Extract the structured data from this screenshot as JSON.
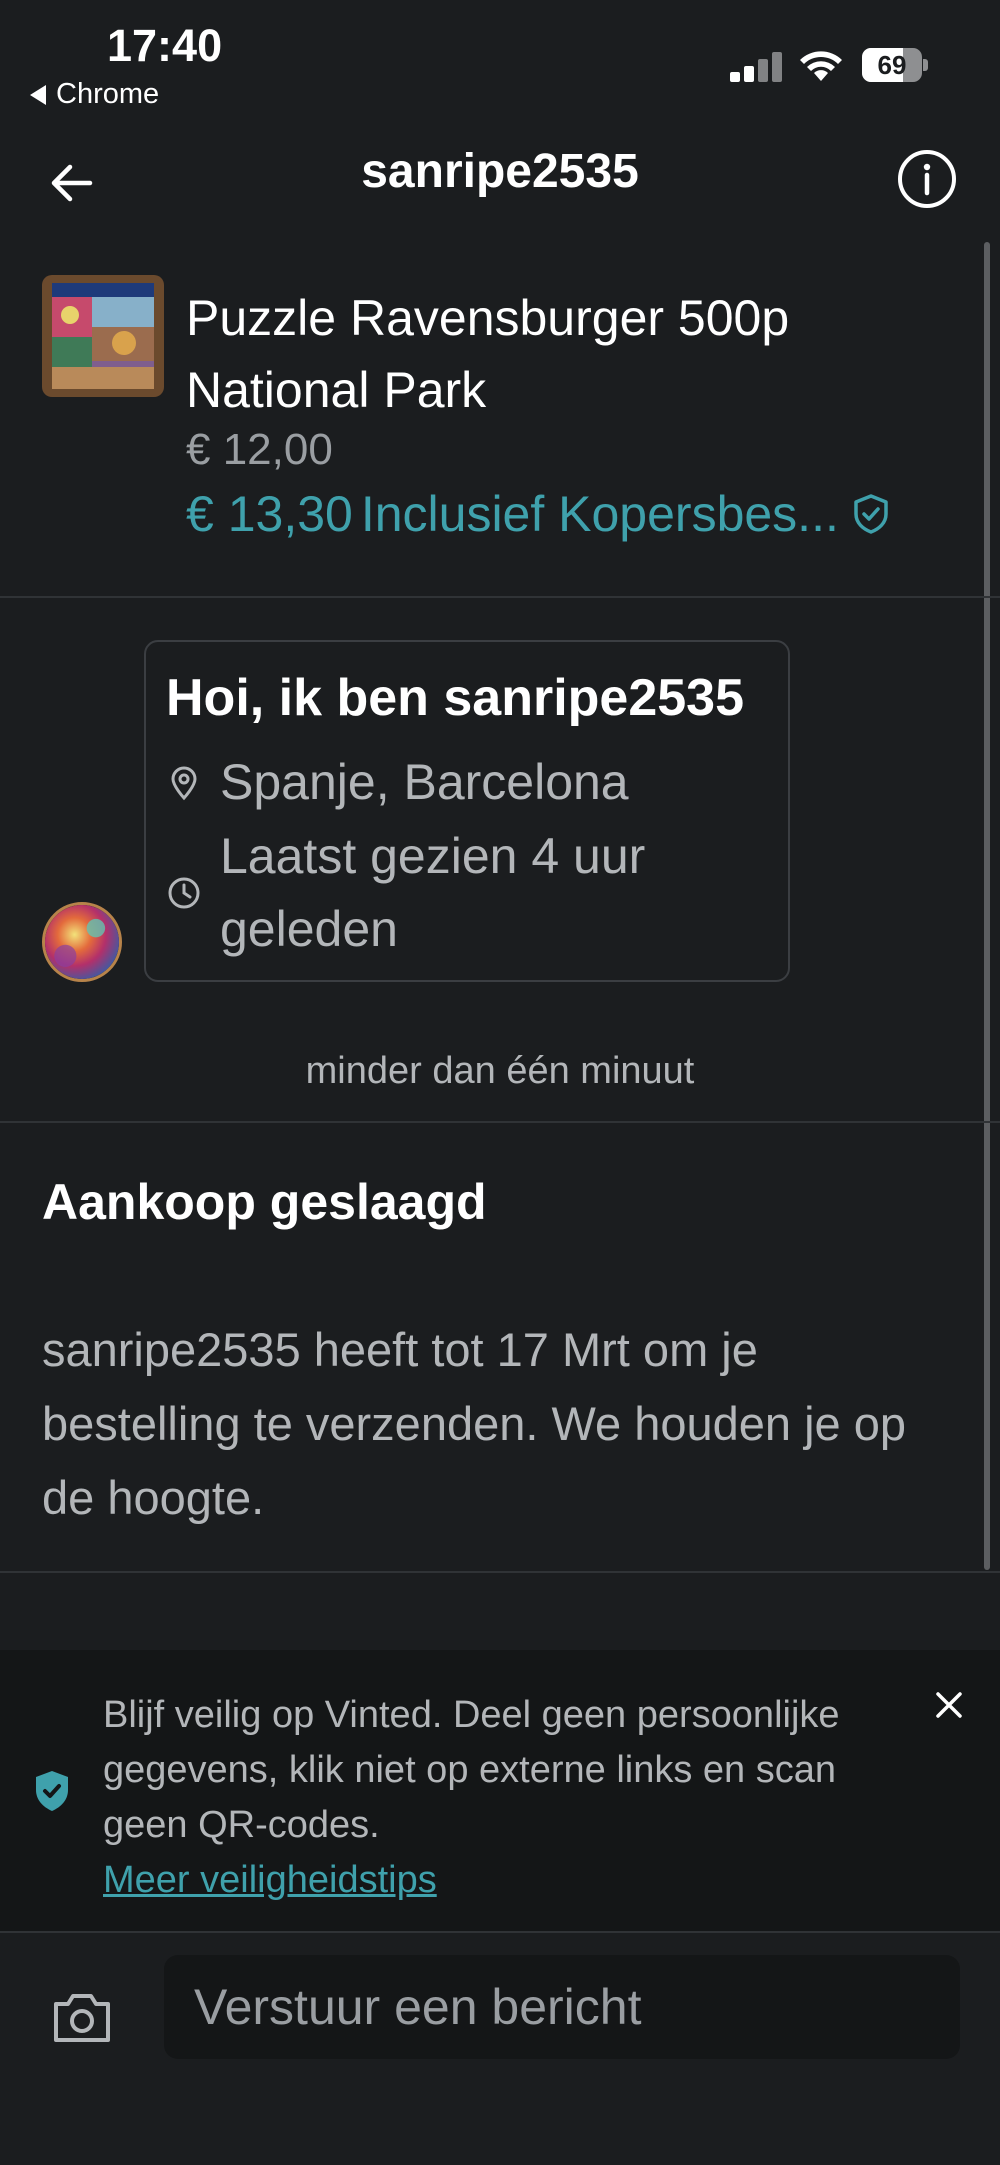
{
  "status_bar": {
    "time": "17:40",
    "back_app": "Chrome",
    "battery": "69",
    "battery_level": 0.69
  },
  "header": {
    "title": "sanripe2535",
    "back_icon": "arrow-left-icon",
    "info_icon": "info-circle-icon"
  },
  "item": {
    "title": "Puzzle Ravensburger 500p National Park",
    "price": "€ 12,00",
    "total_price": "€ 13,30",
    "protection_label": "Inclusief Kopersbes...",
    "shield_icon": "shield-check-icon"
  },
  "profile_card": {
    "greeting": "Hoi, ik ben sanripe2535",
    "location": "Spanje, Barcelona",
    "last_seen": "Laatst gezien 4 uur geleden",
    "location_icon": "map-pin-icon",
    "clock_icon": "clock-icon"
  },
  "timestamp": "minder dan één minuut",
  "purchase": {
    "title": "Aankoop geslaagd",
    "text": "sanripe2535 heeft tot 17 Mrt om je bestelling te verzenden. We houden je op de hoogte."
  },
  "safety": {
    "text": "Blijf veilig op Vinted. Deel geen persoonlijke gegevens, klik niet op externe links en scan geen QR-codes.",
    "link": "Meer veiligheidstips"
  },
  "composer": {
    "placeholder": "Verstuur een bericht",
    "camera_icon": "camera-icon"
  },
  "colors": {
    "background": "#1b1d1f",
    "accent": "#3fa1ac",
    "muted_text": "#b3b6b9",
    "banner_bg": "#141617"
  }
}
